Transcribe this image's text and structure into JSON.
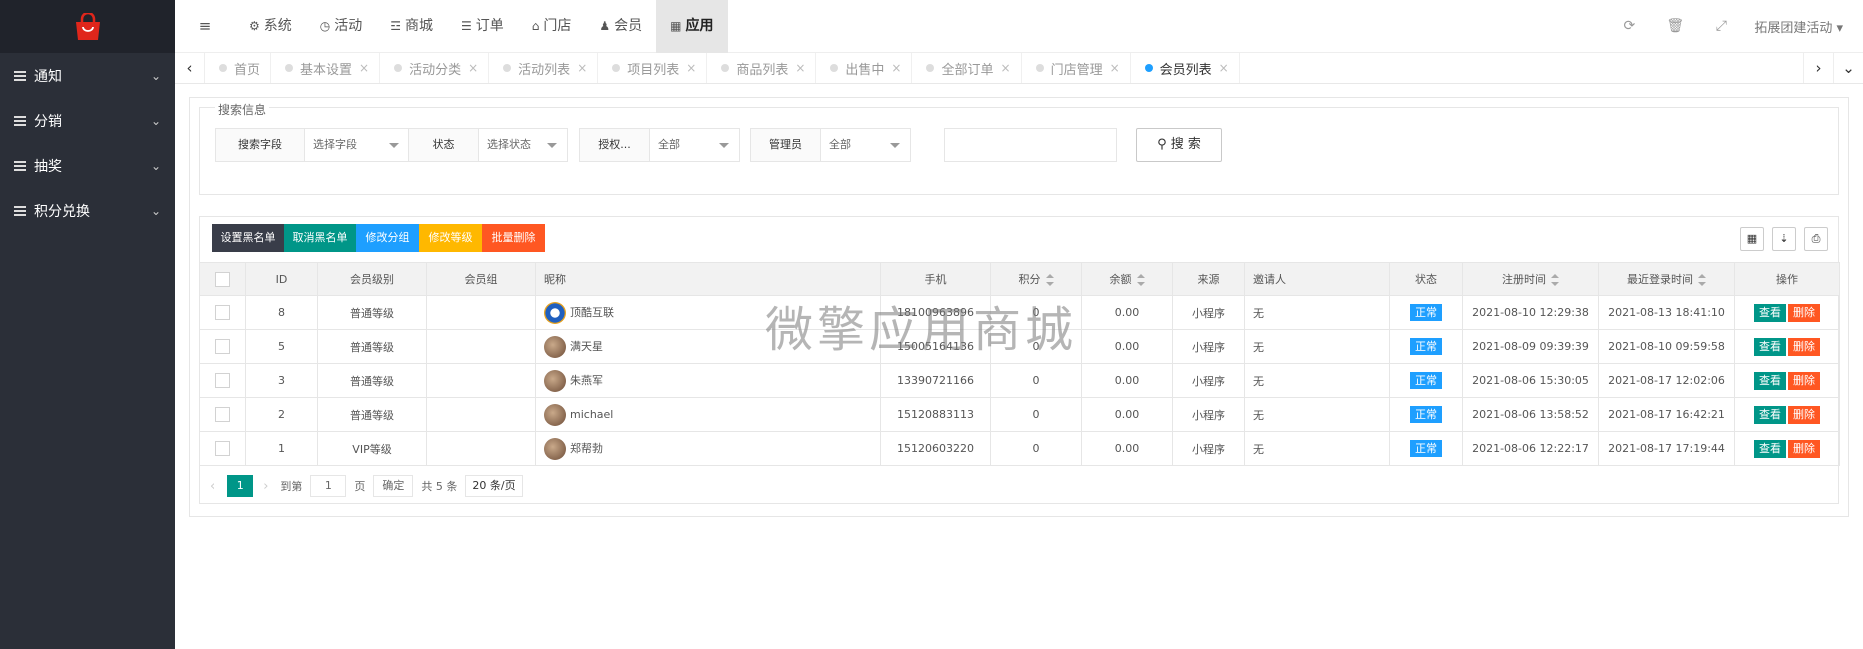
{
  "sidebar": {
    "logo_icon": "shopping-bag-icon",
    "items": [
      {
        "label": "通知"
      },
      {
        "label": "分销"
      },
      {
        "label": "抽奖"
      },
      {
        "label": "积分兑换"
      }
    ]
  },
  "topbar": {
    "toggle_icon": "menu-toggle-icon",
    "items": [
      {
        "label": "系统",
        "icon": "gears-icon"
      },
      {
        "label": "活动",
        "icon": "globe-icon"
      },
      {
        "label": "商城",
        "icon": "cart-icon"
      },
      {
        "label": "订单",
        "icon": "list-icon"
      },
      {
        "label": "门店",
        "icon": "bank-icon"
      },
      {
        "label": "会员",
        "icon": "users-icon"
      },
      {
        "label": "应用",
        "icon": "grid-icon"
      }
    ],
    "active_item": "应用",
    "right_icons": [
      "refresh-icon",
      "trash-icon",
      "fullscreen-icon"
    ],
    "user": "拓展团建活动"
  },
  "tabs": {
    "items": [
      {
        "label": "首页"
      },
      {
        "label": "基本设置"
      },
      {
        "label": "活动分类"
      },
      {
        "label": "活动列表"
      },
      {
        "label": "项目列表"
      },
      {
        "label": "商品列表"
      },
      {
        "label": "出售中"
      },
      {
        "label": "全部订单"
      },
      {
        "label": "门店管理"
      },
      {
        "label": "会员列表"
      }
    ],
    "active": "会员列表"
  },
  "search": {
    "legend": "搜索信息",
    "field_label": "搜索字段",
    "field_value": "选择字段",
    "status_label": "状态",
    "status_value": "选择状态",
    "auth_label": "授权...",
    "auth_value": "全部",
    "admin_label": "管理员",
    "admin_value": "全部",
    "keyword_value": "",
    "button": "搜 索"
  },
  "toolbar": {
    "buttons": [
      {
        "label": "设置黑名单",
        "color": "#393d49"
      },
      {
        "label": "取消黑名单",
        "color": "#009688"
      },
      {
        "label": "修改分组",
        "color": "#1e9fff"
      },
      {
        "label": "修改等级",
        "color": "#ffb800"
      },
      {
        "label": "批量删除",
        "color": "#ff5722"
      }
    ],
    "right_icons": [
      "columns-icon",
      "export-icon",
      "print-icon"
    ]
  },
  "table": {
    "headers": [
      "ID",
      "会员级别",
      "会员组",
      "昵称",
      "手机",
      "积分",
      "余额",
      "来源",
      "邀请人",
      "状态",
      "注册时间",
      "最近登录时间",
      "操作"
    ],
    "rows": [
      {
        "id": "8",
        "level": "普通等级",
        "group": "",
        "nick": "顶酷互联",
        "phone": "18100963896",
        "points": "0",
        "balance": "0.00",
        "source": "小程序",
        "inviter": "无",
        "status": "正常",
        "reg": "2021-08-10 12:29:38",
        "last": "2021-08-13 18:41:10"
      },
      {
        "id": "5",
        "level": "普通等级",
        "group": "",
        "nick": "满天星",
        "phone": "15005164136",
        "points": "0",
        "balance": "0.00",
        "source": "小程序",
        "inviter": "无",
        "status": "正常",
        "reg": "2021-08-09 09:39:39",
        "last": "2021-08-10 09:59:58"
      },
      {
        "id": "3",
        "level": "普通等级",
        "group": "",
        "nick": "朱燕军",
        "phone": "13390721166",
        "points": "0",
        "balance": "0.00",
        "source": "小程序",
        "inviter": "无",
        "status": "正常",
        "reg": "2021-08-06 15:30:05",
        "last": "2021-08-17 12:02:06"
      },
      {
        "id": "2",
        "level": "普通等级",
        "group": "",
        "nick": "michael",
        "phone": "15120883113",
        "points": "0",
        "balance": "0.00",
        "source": "小程序",
        "inviter": "无",
        "status": "正常",
        "reg": "2021-08-06 13:58:52",
        "last": "2021-08-17 16:42:21"
      },
      {
        "id": "1",
        "level": "VIP等级",
        "group": "",
        "nick": "郑帮勃",
        "phone": "15120603220",
        "points": "0",
        "balance": "0.00",
        "source": "小程序",
        "inviter": "无",
        "status": "正常",
        "reg": "2021-08-06 12:22:17",
        "last": "2021-08-17 17:19:44"
      }
    ],
    "view_label": "查看",
    "delete_label": "删除"
  },
  "pager": {
    "current": "1",
    "goto_label": "到第",
    "goto_value": "1",
    "page_unit": "页",
    "confirm": "确定",
    "total": "共 5 条",
    "size": "20 条/页"
  },
  "watermark": "微擎应用商城",
  "colors": {
    "accent": "#009688",
    "sidebar": "#2b2f38",
    "logo_red": "#e0261b"
  }
}
